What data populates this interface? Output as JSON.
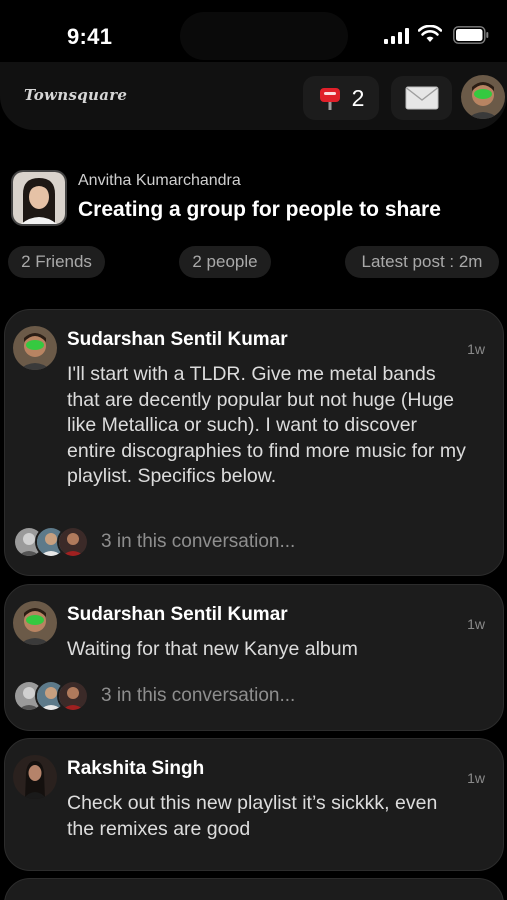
{
  "status_bar": {
    "time": "9:41"
  },
  "header": {
    "logo": "Townsquare",
    "notification_count": "2"
  },
  "group": {
    "owner": "Anvitha Kumarchandra",
    "title": "Creating a group for people to share",
    "chips": {
      "friends": "2 Friends",
      "people": "2 people",
      "latest": "Latest post : 2m"
    }
  },
  "posts": [
    {
      "author": "Sudarshan Sentil Kumar",
      "time": "1w",
      "body": "I'll start with a TLDR. Give me metal bands that are decently popular but not huge (Huge like Metallica or such). I want to discover entire discographies to find more music for my playlist. Specifics below.",
      "conversation": "3 in this conversation..."
    },
    {
      "author": "Sudarshan Sentil Kumar",
      "time": "1w",
      "body": "Waiting for that new Kanye album",
      "conversation": "3 in this conversation..."
    },
    {
      "author": "Rakshita Singh",
      "time": "1w",
      "body": "Check out this new playlist it’s sickkk, even the remixes are good"
    }
  ],
  "colors": {
    "background": "#000000",
    "card": "#1c1c1c",
    "chip": "#1e1e1e",
    "muted_text": "#8e8e8e",
    "notification_red": "#e0202a"
  },
  "icons": {
    "notification": "mailbox-icon",
    "mail": "envelope-icon"
  }
}
